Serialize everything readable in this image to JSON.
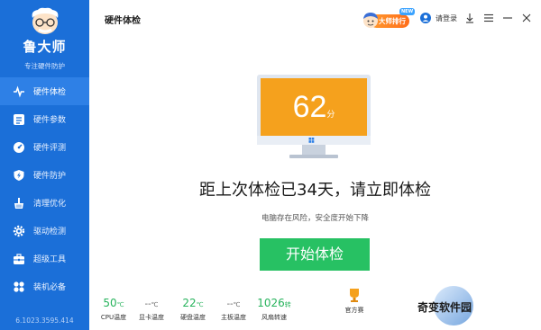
{
  "app": {
    "name": "鲁大师",
    "slogan": "专注硬件防护",
    "version": "6.1023.3595.414"
  },
  "sidebar": {
    "items": [
      {
        "label": "硬件体检",
        "icon": "pulse-icon",
        "active": true
      },
      {
        "label": "硬件参数",
        "icon": "list-icon",
        "active": false
      },
      {
        "label": "硬件评测",
        "icon": "speedometer-icon",
        "active": false
      },
      {
        "label": "硬件防护",
        "icon": "shield-bolt-icon",
        "active": false
      },
      {
        "label": "清理优化",
        "icon": "broom-icon",
        "active": false
      },
      {
        "label": "驱动检测",
        "icon": "gear-icon",
        "active": false
      },
      {
        "label": "超级工具",
        "icon": "toolbox-icon",
        "active": false
      },
      {
        "label": "装机必备",
        "icon": "apps-icon",
        "active": false
      }
    ]
  },
  "header": {
    "title": "硬件体检",
    "rank_label": "大师排行",
    "rank_badge": "NEW",
    "login_label": "请登录"
  },
  "main": {
    "score": "62",
    "score_unit": "分",
    "headline": "距上次体检已34天，请立即体检",
    "subline": "电脑存在风险，安全度开始下降",
    "start_button": "开始体检"
  },
  "stats": [
    {
      "value": "50",
      "unit": "℃",
      "label": "CPU温度",
      "dim": false
    },
    {
      "value": "--",
      "unit": "℃",
      "label": "显卡温度",
      "dim": true
    },
    {
      "value": "22",
      "unit": "℃",
      "label": "硬盘温度",
      "dim": false
    },
    {
      "value": "--",
      "unit": "℃",
      "label": "主板温度",
      "dim": true
    },
    {
      "value": "1026",
      "unit": "转",
      "label": "风扇转速",
      "dim": false
    }
  ],
  "official": {
    "label": "官方赛",
    "icon": "trophy-icon"
  },
  "watermark": {
    "text": "奇变软件园"
  },
  "colors": {
    "sidebar_bg": "#1b6fd8",
    "active_item": "#2e80e6",
    "accent_green": "#27c163",
    "screen_orange": "#f5a11d"
  }
}
